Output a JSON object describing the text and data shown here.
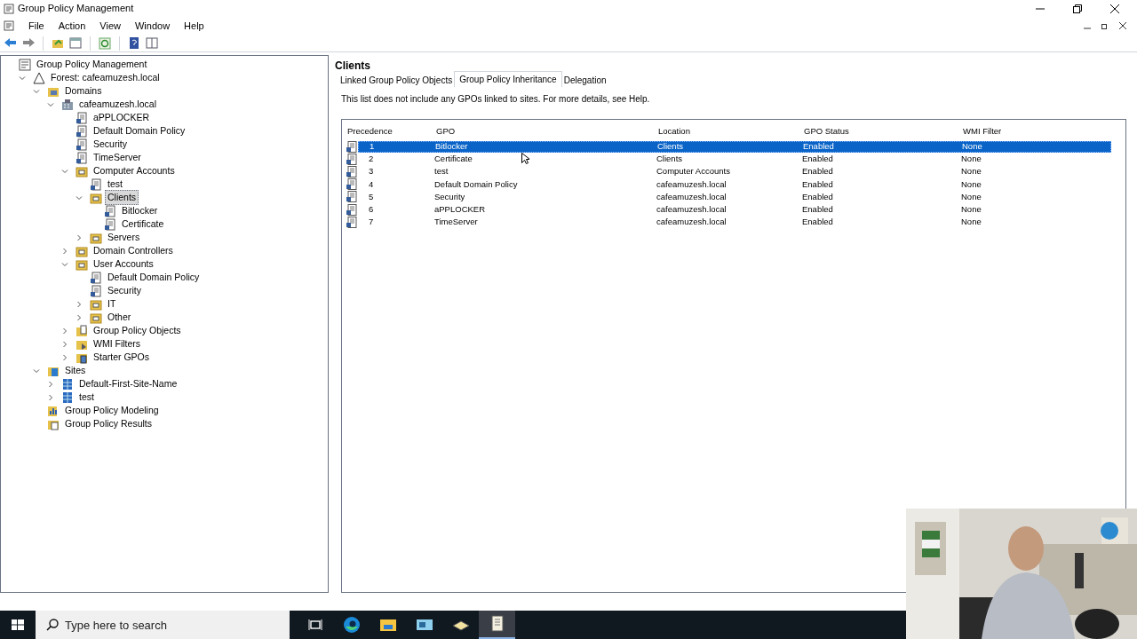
{
  "window": {
    "title": "Group Policy Management"
  },
  "menu": [
    "File",
    "Action",
    "View",
    "Window",
    "Help"
  ],
  "toolbar": [
    {
      "kind": "back"
    },
    {
      "kind": "forward"
    },
    {
      "kind": "folder-up"
    },
    {
      "kind": "console"
    },
    {
      "kind": "refresh"
    },
    {
      "kind": "help"
    },
    {
      "kind": "pane"
    }
  ],
  "tree": [
    {
      "label": "Group Policy Management",
      "kind": "root",
      "selected": false,
      "children": [
        {
          "label": "Forest: cafeamuzesh.local",
          "kind": "forest",
          "expanded": true,
          "selected": false,
          "children": [
            {
              "label": "Domains",
              "kind": "domains",
              "expanded": true,
              "selected": false,
              "children": [
                {
                  "label": "cafeamuzesh.local",
                  "kind": "domain",
                  "expanded": true,
                  "selected": false,
                  "children": [
                    {
                      "label": "aPPLOCKER",
                      "kind": "gpo",
                      "selected": false
                    },
                    {
                      "label": "Default Domain Policy",
                      "kind": "gpo",
                      "selected": false
                    },
                    {
                      "label": "Security",
                      "kind": "gpo",
                      "selected": false
                    },
                    {
                      "label": "TimeServer",
                      "kind": "gpo",
                      "selected": false
                    },
                    {
                      "label": "Computer Accounts",
                      "kind": "ou",
                      "expanded": true,
                      "selected": false,
                      "children": [
                        {
                          "label": "test",
                          "kind": "gpo",
                          "selected": false
                        },
                        {
                          "label": "Clients",
                          "kind": "ou",
                          "expanded": true,
                          "selected": true,
                          "children": [
                            {
                              "label": "Bitlocker",
                              "kind": "gpo",
                              "selected": false
                            },
                            {
                              "label": "Certificate",
                              "kind": "gpo",
                              "selected": false
                            }
                          ]
                        },
                        {
                          "label": "Servers",
                          "kind": "ou",
                          "expanded": false,
                          "selected": false
                        }
                      ]
                    },
                    {
                      "label": "Domain Controllers",
                      "kind": "ou",
                      "expanded": false,
                      "selected": false
                    },
                    {
                      "label": "User Accounts",
                      "kind": "ou",
                      "expanded": true,
                      "selected": false,
                      "children": [
                        {
                          "label": "Default Domain Policy",
                          "kind": "gpo",
                          "selected": false
                        },
                        {
                          "label": "Security",
                          "kind": "gpo",
                          "selected": false
                        },
                        {
                          "label": "IT",
                          "kind": "ou",
                          "expanded": false,
                          "selected": false
                        },
                        {
                          "label": "Other",
                          "kind": "ou",
                          "expanded": false,
                          "selected": false
                        }
                      ]
                    },
                    {
                      "label": "Group Policy Objects",
                      "kind": "gpo-folder",
                      "expanded": false,
                      "selected": false
                    },
                    {
                      "label": "WMI Filters",
                      "kind": "wmi",
                      "expanded": false,
                      "selected": false
                    },
                    {
                      "label": "Starter GPOs",
                      "kind": "starter",
                      "expanded": false,
                      "selected": false
                    }
                  ]
                }
              ]
            },
            {
              "label": "Sites",
              "kind": "sites",
              "expanded": true,
              "selected": false,
              "children": [
                {
                  "label": "Default-First-Site-Name",
                  "kind": "site",
                  "expanded": false,
                  "selected": false
                },
                {
                  "label": "test",
                  "kind": "site",
                  "expanded": false,
                  "selected": false
                }
              ]
            },
            {
              "label": "Group Policy Modeling",
              "kind": "modeling",
              "selected": false
            },
            {
              "label": "Group Policy Results",
              "kind": "results",
              "selected": false
            }
          ]
        }
      ]
    }
  ],
  "details": {
    "title": "Clients",
    "tabs": [
      {
        "label": "Linked Group Policy Objects",
        "selected": false
      },
      {
        "label": "Group Policy Inheritance",
        "selected": true
      },
      {
        "label": "Delegation",
        "selected": false
      }
    ],
    "note": "This list does not include any GPOs linked to sites. For more details, see Help.",
    "table": {
      "columns": [
        "Precedence",
        "GPO",
        "Location",
        "GPO Status",
        "WMI Filter"
      ],
      "rows": [
        {
          "cells": [
            "1",
            "Bitlocker",
            "Clients",
            "Enabled",
            "None"
          ],
          "selected": true
        },
        {
          "cells": [
            "2",
            "Certificate",
            "Clients",
            "Enabled",
            "None"
          ],
          "selected": false
        },
        {
          "cells": [
            "3",
            "test",
            "Computer Accounts",
            "Enabled",
            "None"
          ],
          "selected": false
        },
        {
          "cells": [
            "4",
            "Default Domain Policy",
            "cafeamuzesh.local",
            "Enabled",
            "None"
          ],
          "selected": false
        },
        {
          "cells": [
            "5",
            "Security",
            "cafeamuzesh.local",
            "Enabled",
            "None"
          ],
          "selected": false
        },
        {
          "cells": [
            "6",
            "aPPLOCKER",
            "cafeamuzesh.local",
            "Enabled",
            "None"
          ],
          "selected": false
        },
        {
          "cells": [
            "7",
            "TimeServer",
            "cafeamuzesh.local",
            "Enabled",
            "None"
          ],
          "selected": false
        }
      ]
    }
  },
  "taskbar": {
    "search": {
      "placeholder": "Type here to search"
    },
    "apps": [
      {
        "kind": "task-view",
        "active": false
      },
      {
        "kind": "browser",
        "active": false
      },
      {
        "kind": "files",
        "active": false
      },
      {
        "kind": "console",
        "active": false
      },
      {
        "kind": "tool",
        "active": false
      },
      {
        "kind": "gpm",
        "active": true
      }
    ]
  }
}
